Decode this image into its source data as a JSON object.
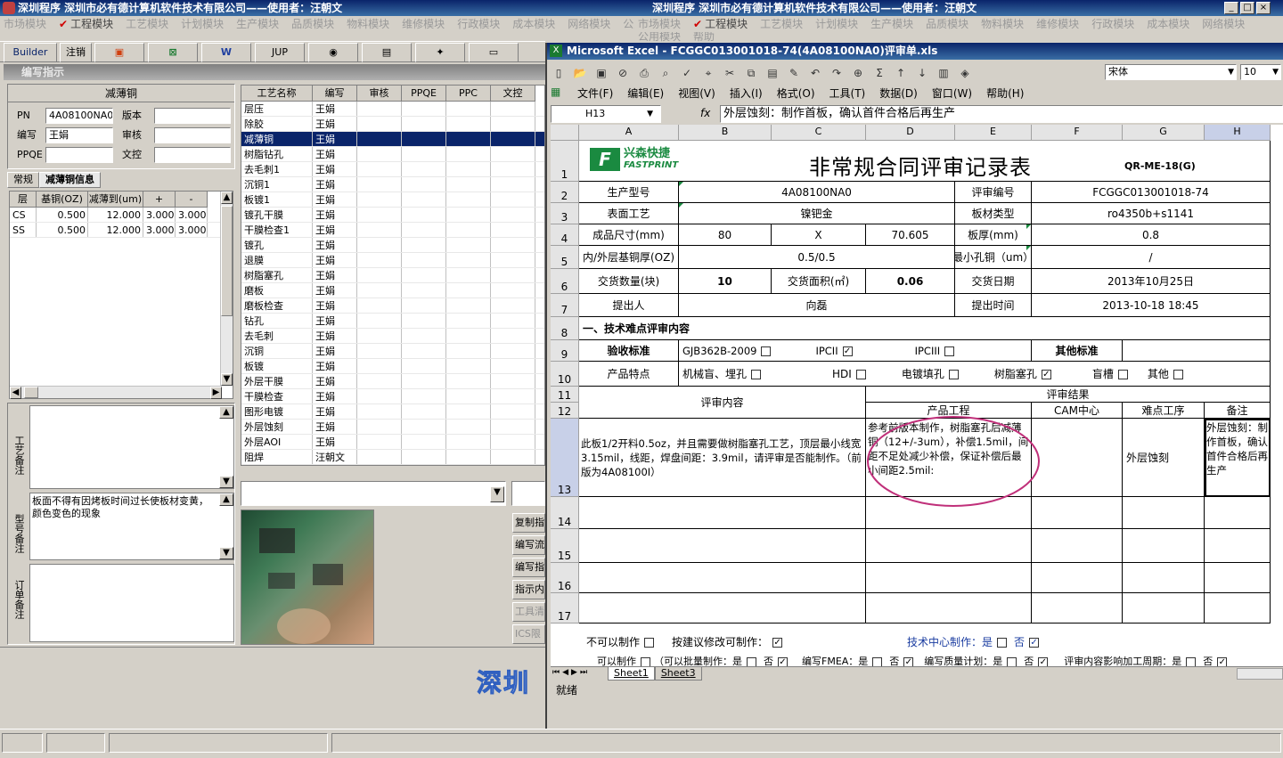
{
  "left_window": {
    "title": "深圳程序  深圳市必有德计算机软件技术有限公司——使用者：汪朝文",
    "menu": [
      "市场模块",
      "工程模块",
      "工艺模块",
      "计划模块",
      "生产模块",
      "品质模块",
      "物料模块",
      "维修模块",
      "行政模块",
      "成本模块",
      "网络模块",
      "公用"
    ],
    "toolbar": {
      "builder": "Builder",
      "cancel": "注销",
      "jup": "JUP"
    },
    "sub_title": "编写指示",
    "group_title": "减薄铜",
    "pn_label": "PN",
    "pn_value": "4A08100NA0",
    "version_label": "版本",
    "author_label": "编写",
    "author_value": "王娟",
    "review_label": "审核",
    "ppqe_label": "PPQE",
    "doc_label": "文控",
    "tabs": [
      "常规",
      "减薄铜信息"
    ],
    "layer_table": {
      "headers": [
        "层",
        "基铜(OZ)",
        "减薄到(um)",
        "+",
        "-"
      ],
      "rows": [
        [
          "CS",
          "0.500",
          "12.000",
          "3.000",
          "3.000"
        ],
        [
          "SS",
          "0.500",
          "12.000",
          "3.000",
          "3.000"
        ]
      ]
    },
    "process_note_label": "工艺备注",
    "model_note_label": "型号备注",
    "model_note_value": "板面不得有因烤板时间过长使板材变黄，颜色变色的现象",
    "order_note_label": "订单备注",
    "process_table": {
      "headers": [
        "工艺名称",
        "编写",
        "审核",
        "PPQE",
        "PPC",
        "文控"
      ],
      "rows": [
        [
          "层压",
          "王娟"
        ],
        [
          "除胶",
          "王娟"
        ],
        [
          "减薄铜",
          "王娟"
        ],
        [
          "树脂钻孔",
          "王娟"
        ],
        [
          "去毛刺1",
          "王娟"
        ],
        [
          "沉铜1",
          "王娟"
        ],
        [
          "板镀1",
          "王娟"
        ],
        [
          "镀孔干膜",
          "王娟"
        ],
        [
          "干膜检查1",
          "王娟"
        ],
        [
          "镀孔",
          "王娟"
        ],
        [
          "退膜",
          "王娟"
        ],
        [
          "树脂塞孔",
          "王娟"
        ],
        [
          "磨板",
          "王娟"
        ],
        [
          "磨板检查",
          "王娟"
        ],
        [
          "钻孔",
          "王娟"
        ],
        [
          "去毛刺",
          "王娟"
        ],
        [
          "沉铜",
          "王娟"
        ],
        [
          "板镀",
          "王娟"
        ],
        [
          "外层干膜",
          "王娟"
        ],
        [
          "干膜检查",
          "王娟"
        ],
        [
          "图形电镀",
          "王娟"
        ],
        [
          "外层蚀刻",
          "王娟"
        ],
        [
          "外层AOI",
          "王娟"
        ],
        [
          "阻焊",
          "汪朝文"
        ]
      ],
      "selected": 2
    },
    "side_buttons": [
      "复制指",
      "编写流",
      "编写指",
      "指示内",
      "工具清",
      "ICS限"
    ],
    "watermark": "深圳"
  },
  "right_window": {
    "title": "深圳程序  深圳市必有德计算机软件技术有限公司——使用者：汪朝文",
    "menu": [
      "市场模块",
      "工程模块",
      "工艺模块",
      "计划模块",
      "生产模块",
      "品质模块",
      "物料模块",
      "维修模块",
      "行政模块",
      "成本模块",
      "网络模块"
    ],
    "menu2": [
      "公用模块",
      "帮助"
    ]
  },
  "excel": {
    "title": "Microsoft Excel - FCGGC013001018-74(4A08100NA0)评审单.xls",
    "font_name": "宋体",
    "font_size": "10",
    "menu": [
      "文件(F)",
      "编辑(E)",
      "视图(V)",
      "插入(I)",
      "格式(O)",
      "工具(T)",
      "数据(D)",
      "窗口(W)",
      "帮助(H)"
    ],
    "name_box": "H13",
    "formula": "外层蚀刻：制作首板，确认首件合格后再生产",
    "cols": [
      "A",
      "B",
      "C",
      "D",
      "E",
      "F",
      "G",
      "H"
    ],
    "rows": [
      "1",
      "2",
      "3",
      "4",
      "5",
      "6",
      "7",
      "8",
      "9",
      "10",
      "11",
      "12",
      "13",
      "14",
      "15",
      "16",
      "17"
    ],
    "logo_cn": "兴森快捷",
    "logo_en": "FASTPRINT",
    "doc_title": "非常规合同评审记录表",
    "doc_code": "QR-ME-18(G)",
    "r2": [
      "生产型号",
      "4A08100NA0",
      "评审编号",
      "FCGGC013001018-74"
    ],
    "r3": [
      "表面工艺",
      "镍钯金",
      "板材类型",
      "ro4350b+s1141"
    ],
    "r4": [
      "成品尺寸(mm)",
      "80",
      "X",
      "70.605",
      "板厚(mm)",
      "0.8"
    ],
    "r5": [
      "内/外层基铜厚(OZ)",
      "0.5/0.5",
      "最小孔铜（um）",
      "/"
    ],
    "r6": [
      "交货数量(块)",
      "10",
      "交货面积(㎡)",
      "0.06",
      "交货日期",
      "2013年10月25日"
    ],
    "r7": [
      "提出人",
      "向磊",
      "提出时间",
      "2013-10-18 18:45"
    ],
    "r8": "一、技术难点评审内容",
    "r9": [
      "验收标准",
      "GJB362B-2009",
      "IPCII",
      "IPCIII",
      "其他标准"
    ],
    "r10": [
      "产品特点",
      "机械盲、埋孔",
      "HDI",
      "电镀填孔",
      "树脂塞孔",
      "盲槽",
      "其他"
    ],
    "r11": [
      "评审内容",
      "评审结果"
    ],
    "r12": [
      "产品工程",
      "CAM中心",
      "难点工序",
      "备注"
    ],
    "r13_content": "此板1/2开料0.5oz，并且需要做树脂塞孔工艺，顶层最小线宽3.15mil，线距，焊盘间距：3.9mil，请评审是否能制作。（前版为4A08100I）",
    "r13_eng": "参考前版本制作，树脂塞孔后减薄铜（12+/-3um），补偿1.5mil，间距不足处减少补偿，保证补偿后最小间距2.5mil:",
    "r13_proc": "外层蚀刻",
    "r13_note": "外层蚀刻：制作首板，确认首件合格后再生产",
    "bottom1": [
      "不可以制作",
      "按建议修改可制作：",
      "技术中心制作：是",
      "否"
    ],
    "bottom2": [
      "可以制作",
      "（可以批量制作：是",
      "否",
      "编写FMEA：是",
      "否",
      "编写质量计划：是",
      "否",
      "评审内容影响加工周期：是",
      "否"
    ],
    "sheets": [
      "Sheet1",
      "Sheet3"
    ],
    "status": "就绪"
  }
}
